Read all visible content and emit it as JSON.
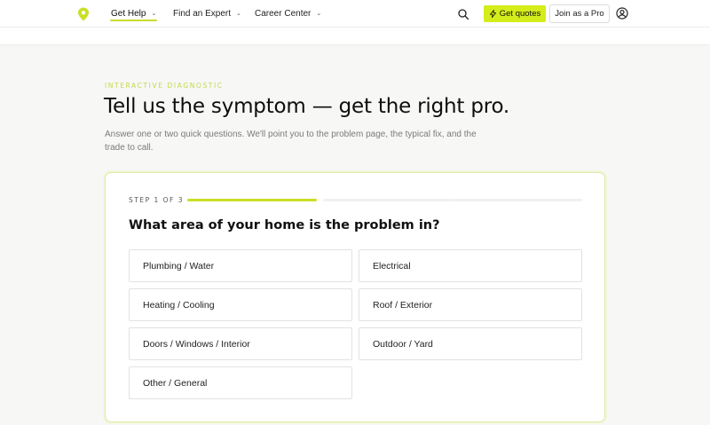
{
  "header": {
    "nav": [
      {
        "label": "Get Help",
        "active": true
      },
      {
        "label": "Find an Expert",
        "active": false
      },
      {
        "label": "Career Center",
        "active": false
      }
    ],
    "search_icon": "search-icon",
    "get_quotes_label": "Get quotes",
    "join_pro_label": "Join as a Pro",
    "user_icon": "user-circle-icon"
  },
  "hero": {
    "eyebrow": "INTERACTIVE DIAGNOSTIC",
    "title": "Tell us the symptom — get the right pro.",
    "intro": "Answer one or two quick questions. We'll point you to the problem page, the typical fix, and the trade to call."
  },
  "diagnostic": {
    "step_label": "STEP 1 OF 3",
    "current_step": 1,
    "total_steps": 3,
    "question": "What area of your home is the problem in?",
    "options": [
      "Plumbing / Water",
      "Electrical",
      "Heating / Cooling",
      "Roof / Exterior",
      "Doors / Windows / Interior",
      "Outdoor / Yard",
      "Other / General"
    ]
  },
  "colors": {
    "accent": "#d4ec1a",
    "progress": "#c9df24",
    "eyebrow": "#c4d84a"
  }
}
